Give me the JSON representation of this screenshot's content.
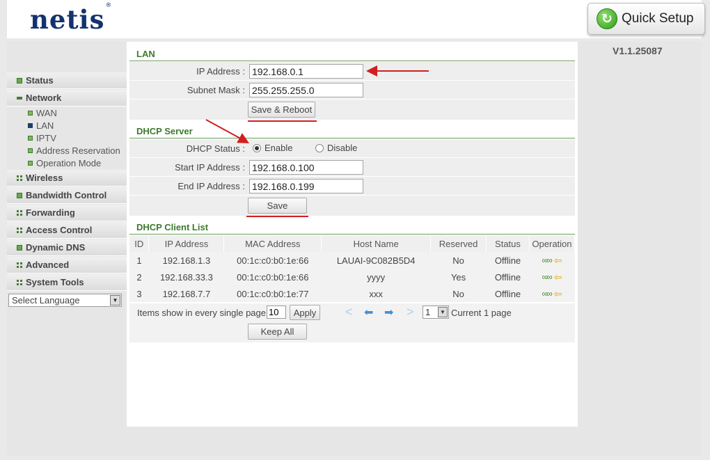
{
  "header": {
    "logo": "netis",
    "logo_mark": "®",
    "quick_setup_label": "Quick Setup",
    "version": "V1.1.25087"
  },
  "sidebar": {
    "items": [
      {
        "label": "Status",
        "icon": "plus-square-icon"
      },
      {
        "label": "Network",
        "icon": "minus-icon"
      },
      {
        "label": "Wireless",
        "icon": "grid-icon"
      },
      {
        "label": "Bandwidth Control",
        "icon": "plus-square-icon"
      },
      {
        "label": "Forwarding",
        "icon": "grid-icon"
      },
      {
        "label": "Access Control",
        "icon": "grid-icon"
      },
      {
        "label": "Dynamic DNS",
        "icon": "plus-square-icon"
      },
      {
        "label": "Advanced",
        "icon": "grid-icon"
      },
      {
        "label": "System Tools",
        "icon": "grid-icon"
      }
    ],
    "network_sub": [
      "WAN",
      "LAN",
      "IPTV",
      "Address Reservation",
      "Operation Mode"
    ],
    "active_sub": "LAN",
    "language_select": "Select Language"
  },
  "lan": {
    "title": "LAN",
    "ip_label": "IP Address :",
    "ip_value": "192.168.0.1",
    "mask_label": "Subnet Mask :",
    "mask_value": "255.255.255.0",
    "save_reboot_label": "Save & Reboot"
  },
  "dhcp": {
    "title": "DHCP Server",
    "status_label": "DHCP Status :",
    "enable_label": "Enable",
    "disable_label": "Disable",
    "status_value": "Enable",
    "start_label": "Start IP Address :",
    "start_value": "192.168.0.100",
    "end_label": "End IP Address :",
    "end_value": "192.168.0.199",
    "save_label": "Save"
  },
  "client_list": {
    "title": "DHCP Client List",
    "columns": [
      "ID",
      "IP Address",
      "MAC Address",
      "Host Name",
      "Reserved",
      "Status",
      "Operation"
    ],
    "rows": [
      {
        "id": "1",
        "ip": "192.168.1.3",
        "mac": "00:1c:c0:b0:1e:66",
        "host": "LAUAI-9C082B5D4",
        "reserved": "No",
        "status": "Offline"
      },
      {
        "id": "2",
        "ip": "192.168.33.3",
        "mac": "00:1c:c0:b0:1e:66",
        "host": "yyyy",
        "reserved": "Yes",
        "status": "Offline"
      },
      {
        "id": "3",
        "ip": "192.168.7.7",
        "mac": "00:1c:c0:b0:1e:77",
        "host": "xxx",
        "reserved": "No",
        "status": "Offline"
      }
    ],
    "items_per_page_label": "Items show in every single page",
    "items_per_page_value": "10",
    "apply_label": "Apply",
    "page_value": "1",
    "current_page_text": "Current 1 page",
    "keep_all_label": "Keep All"
  },
  "colors": {
    "section_title": "#3c7a2c",
    "annotation_red": "#d21e1e",
    "logo_navy": "#14326e"
  }
}
